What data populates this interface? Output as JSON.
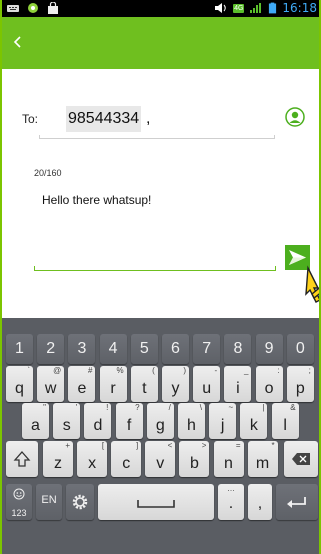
{
  "status_bar": {
    "time": "16:18",
    "network_badge": "4G",
    "left_icons": [
      "keyboard-icon",
      "app-icon",
      "bag-icon"
    ],
    "right_icons": [
      "speaker-icon",
      "network-4g-icon",
      "signal-icon",
      "battery-icon"
    ]
  },
  "header": {
    "back_icon": "back-chevron-icon",
    "accent_color": "#6fbf1f"
  },
  "compose": {
    "to_label": "To:",
    "recipient": "98544334",
    "recipient_separator": ",",
    "contact_icon": "contact-icon",
    "char_count": "20/160",
    "message": "Hello there whatsup!",
    "send_icon": "send-icon"
  },
  "keyboard": {
    "row_numbers": [
      "1",
      "2",
      "3",
      "4",
      "5",
      "6",
      "7",
      "8",
      "9",
      "0"
    ],
    "row_q": [
      {
        "main": "q",
        "sub": "`"
      },
      {
        "main": "w",
        "sub": "@"
      },
      {
        "main": "e",
        "sub": "#"
      },
      {
        "main": "r",
        "sub": "%"
      },
      {
        "main": "t",
        "sub": "("
      },
      {
        "main": "y",
        "sub": ")"
      },
      {
        "main": "u",
        "sub": "-"
      },
      {
        "main": "i",
        "sub": "_"
      },
      {
        "main": "o",
        "sub": ":"
      },
      {
        "main": "p",
        "sub": ";"
      }
    ],
    "row_a": [
      {
        "main": "a",
        "sub": "\""
      },
      {
        "main": "s",
        "sub": "'"
      },
      {
        "main": "d",
        "sub": "!"
      },
      {
        "main": "f",
        "sub": "?"
      },
      {
        "main": "g",
        "sub": "/"
      },
      {
        "main": "h",
        "sub": "\\"
      },
      {
        "main": "j",
        "sub": "~"
      },
      {
        "main": "k",
        "sub": "|"
      },
      {
        "main": "l",
        "sub": "&"
      }
    ],
    "row_z": [
      {
        "main": "z",
        "sub": "+"
      },
      {
        "main": "x",
        "sub": "["
      },
      {
        "main": "c",
        "sub": "]"
      },
      {
        "main": "v",
        "sub": "<"
      },
      {
        "main": "b",
        "sub": ">"
      },
      {
        "main": "n",
        "sub": "="
      },
      {
        "main": "m",
        "sub": "*"
      }
    ],
    "emoji_label": "123",
    "lang_label": "EN",
    "period_label": ".",
    "comma_label": ",",
    "shift_icon": "shift-icon",
    "delete_icon": "delete-icon",
    "settings_icon": "gear-icon",
    "space_icon": "space-icon",
    "enter_icon": "enter-icon"
  }
}
